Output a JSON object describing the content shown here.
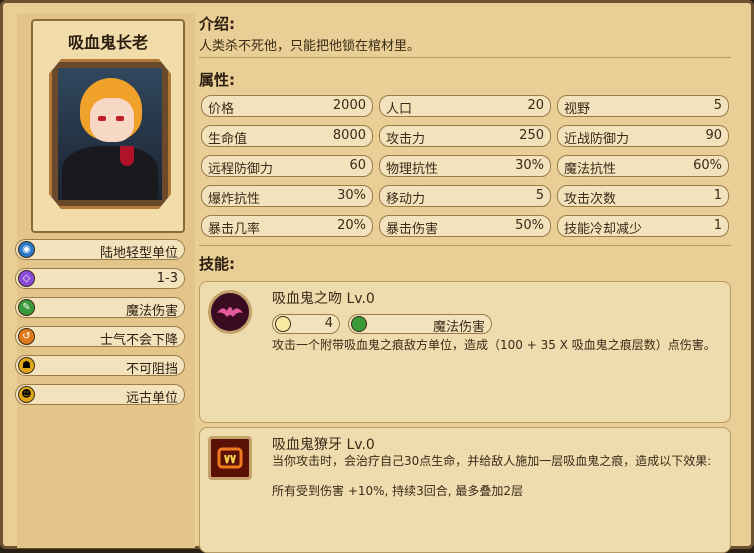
{
  "unit": {
    "name": "吸血鬼长老",
    "tags": [
      {
        "icon": "light-infantry-icon",
        "label": "陆地轻型单位",
        "color": "#2a78c8"
      },
      {
        "icon": "range-icon",
        "label": "1-3",
        "color": "#8a4ad8"
      },
      {
        "icon": "magic-damage-icon",
        "label": "魔法伤害",
        "color": "#3a9a3a"
      },
      {
        "icon": "morale-icon",
        "label": "士气不会下降",
        "color": "#e07a18"
      },
      {
        "icon": "unstoppable-icon",
        "label": "不可阻挡",
        "color": "#e0a818"
      },
      {
        "icon": "ancient-icon",
        "label": "远古单位",
        "color": "#e0a818"
      }
    ]
  },
  "intro": {
    "title": "介绍:",
    "text": "人类杀不死他，只能把他锁在棺材里。"
  },
  "attributes": {
    "title": "属性:",
    "rows": [
      [
        {
          "name": "价格",
          "value": "2000"
        },
        {
          "name": "人口",
          "value": "20"
        },
        {
          "name": "视野",
          "value": "5"
        }
      ],
      [
        {
          "name": "生命值",
          "value": "8000"
        },
        {
          "name": "攻击力",
          "value": "250"
        },
        {
          "name": "近战防御力",
          "value": "90"
        }
      ],
      [
        {
          "name": "远程防御力",
          "value": "60"
        },
        {
          "name": "物理抗性",
          "value": "30%"
        },
        {
          "name": "魔法抗性",
          "value": "60%"
        }
      ],
      [
        {
          "name": "爆炸抗性",
          "value": "30%"
        },
        {
          "name": "移动力",
          "value": "5"
        },
        {
          "name": "攻击次数",
          "value": "1"
        }
      ],
      [
        {
          "name": "暴击几率",
          "value": "20%"
        },
        {
          "name": "暴击伤害",
          "value": "50%"
        },
        {
          "name": "技能冷却减少",
          "value": "1"
        }
      ]
    ]
  },
  "skills": {
    "title": "技能:",
    "items": [
      {
        "icon": "bat-icon",
        "name": "吸血鬼之吻 Lv.0",
        "cooldown": "4",
        "damage_type": "魔法伤害",
        "desc": "攻击一个附带吸血鬼之痕敌方单位，造成（100 + 35 X 吸血鬼之痕层数）点伤害。"
      },
      {
        "icon": "fang-icon",
        "name": "吸血鬼獠牙 Lv.0",
        "desc": "当你攻击时，会治疗自己30点生命，并给敌人施加一层吸血鬼之痕，造成以下效果:",
        "desc2": "所有受到伤害 +10%, 持续3回合, 最多叠加2层"
      }
    ]
  }
}
